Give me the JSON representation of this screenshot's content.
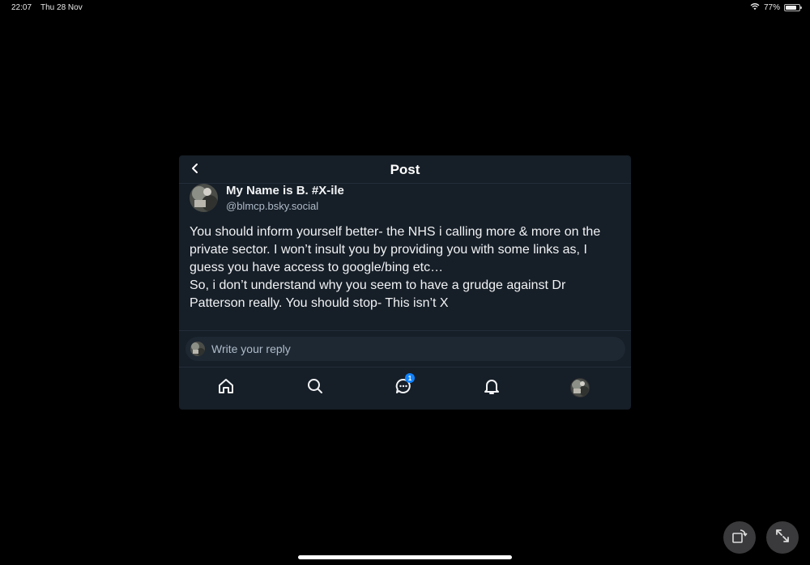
{
  "status_bar": {
    "time": "22:07",
    "date": "Thu 28 Nov",
    "battery": "77%",
    "battery_level": 0.77
  },
  "header": {
    "title": "Post"
  },
  "post": {
    "display_name": "My Name is B. #X-ile",
    "handle": "@blmcp.bsky.social",
    "text": "You should inform yourself better- the NHS i calling more & more on the private sector. I won’t insult you by providing you with some links as, I guess you have access to google/bing etc…\nSo, i don’t understand why you seem to have a grudge against Dr Patterson really. You should stop- This isn’t X"
  },
  "reply": {
    "placeholder": "Write your reply"
  },
  "tabs": [
    {
      "name": "home-icon"
    },
    {
      "name": "search-icon"
    },
    {
      "name": "messages-icon",
      "badge": "1"
    },
    {
      "name": "bell-icon"
    },
    {
      "name": "profile-avatar"
    }
  ],
  "colors": {
    "background": "#000000",
    "panel": "#161e27",
    "accent": "#1083fe",
    "muted_text": "#aebbc9"
  }
}
